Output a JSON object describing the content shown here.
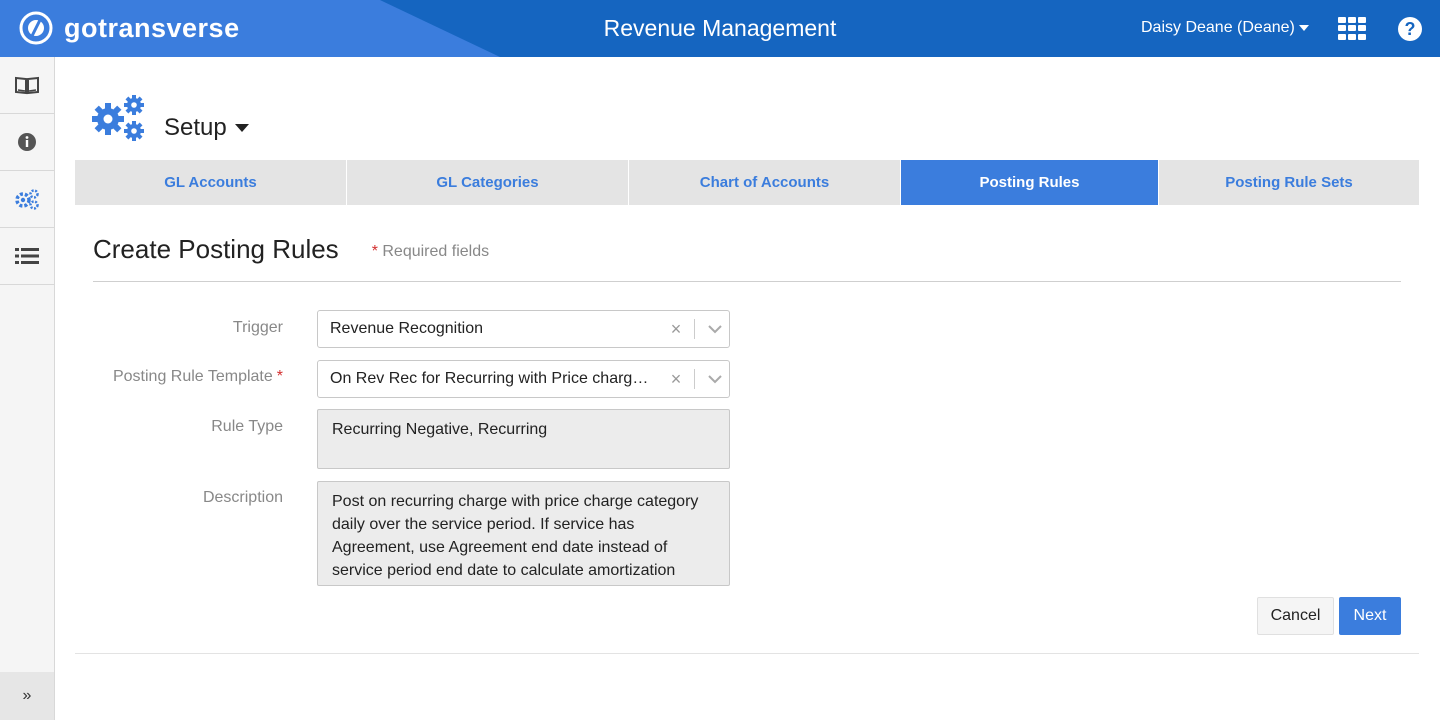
{
  "header": {
    "brand": "gotransverse",
    "app_title": "Revenue Management",
    "user": "Daisy Deane (Deane)",
    "help_label": "?"
  },
  "sidebar": {
    "items": [
      {
        "icon": "book-icon"
      },
      {
        "icon": "info-icon"
      },
      {
        "icon": "gears-icon"
      },
      {
        "icon": "list-icon"
      }
    ],
    "expand_label": "»"
  },
  "page": {
    "section_title": "Setup"
  },
  "tabs": [
    {
      "label": "GL Accounts",
      "active": false
    },
    {
      "label": "GL Categories",
      "active": false
    },
    {
      "label": "Chart of Accounts",
      "active": false
    },
    {
      "label": "Posting Rules",
      "active": true
    },
    {
      "label": "Posting Rule Sets",
      "active": false
    }
  ],
  "form": {
    "title": "Create Posting Rules",
    "required_star": "*",
    "required_note": "Required fields",
    "fields": {
      "trigger": {
        "label": "Trigger",
        "value": "Revenue Recognition"
      },
      "template": {
        "label": "Posting Rule Template",
        "required_star": "*",
        "value": "On Rev Rec for Recurring with Price charge category daily over the service period"
      },
      "rule_type": {
        "label": "Rule Type",
        "value": "Recurring Negative, Recurring"
      },
      "description": {
        "label": "Description",
        "value": "Post on recurring charge with price charge category daily over the service period. If service has Agreement, use Agreement end date instead of service period end date to calculate amortization"
      }
    },
    "clear_glyph": "×",
    "cancel_label": "Cancel",
    "next_label": "Next"
  },
  "colors": {
    "header_blue": "#1565c0",
    "accent_blue": "#3b7ddd",
    "required_red": "#d32f2f"
  }
}
